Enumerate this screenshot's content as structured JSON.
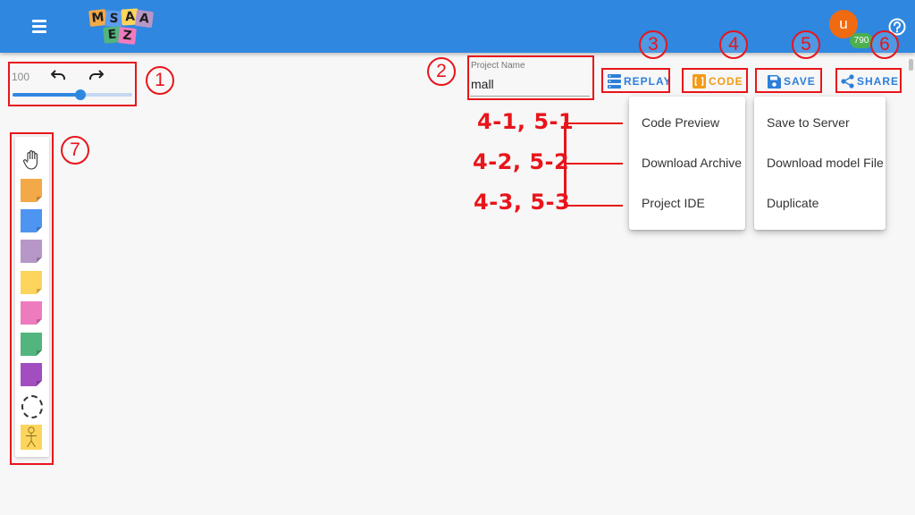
{
  "app": {
    "logo_letters": [
      "M",
      "S",
      "A",
      "E",
      "Z"
    ],
    "user_initial": "u",
    "user_points": "790"
  },
  "zoom": {
    "value": "100",
    "level_percent": 57
  },
  "project": {
    "label": "Project Name",
    "value": "mall"
  },
  "toolbar": {
    "replay_label": "REPLAY",
    "code_label": "CODE",
    "save_label": "SAVE",
    "share_label": "SHARE"
  },
  "code_menu": [
    "Code Preview",
    "Download Archive",
    "Project IDE"
  ],
  "save_menu": [
    "Save to Server",
    "Download model File",
    "Duplicate"
  ],
  "annotations": {
    "numbers": [
      "1",
      "2",
      "3",
      "4",
      "5",
      "6",
      "7"
    ],
    "rows": [
      "4-1, 5-1",
      "4-2, 5-2",
      "4-3, 5-3"
    ]
  },
  "palette": {
    "colors": [
      "#f3a948",
      "#4e95f2",
      "#b797c8",
      "#fdd55c",
      "#ef7bbf",
      "#52b57e",
      "#a24ec1"
    ]
  },
  "colors": {
    "topbar": "#2f87e0",
    "annotation": "#e8151b",
    "code_accent": "#f49a15",
    "action_blue": "#2d7fd8"
  }
}
